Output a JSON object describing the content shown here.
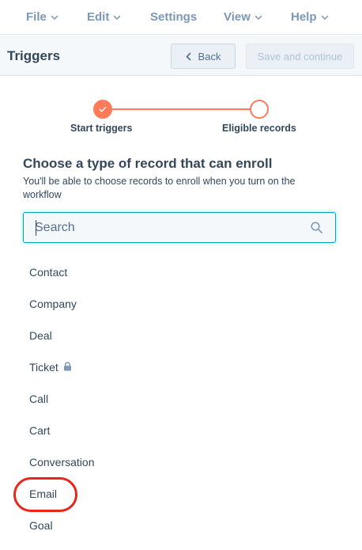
{
  "menu": {
    "items": [
      {
        "label": "File"
      },
      {
        "label": "Edit"
      },
      {
        "label": "Settings"
      },
      {
        "label": "View"
      },
      {
        "label": "Help"
      }
    ]
  },
  "header": {
    "title": "Triggers",
    "back_label": "Back",
    "save_label": "Save and continue"
  },
  "stepper": {
    "steps": [
      {
        "label": "Start triggers",
        "status": "complete"
      },
      {
        "label": "Eligible records",
        "status": "upcoming"
      }
    ],
    "accent_color": "#ff7a59"
  },
  "section": {
    "title": "Choose a type of record that can enroll",
    "subtitle": "You'll be able to choose records to enroll when you turn on the workflow"
  },
  "search": {
    "placeholder": "Search",
    "value": ""
  },
  "records": {
    "items": [
      {
        "label": "Contact",
        "locked": false
      },
      {
        "label": "Company",
        "locked": false
      },
      {
        "label": "Deal",
        "locked": false
      },
      {
        "label": "Ticket",
        "locked": true
      },
      {
        "label": "Call",
        "locked": false
      },
      {
        "label": "Cart",
        "locked": false
      },
      {
        "label": "Conversation",
        "locked": false
      },
      {
        "label": "Email",
        "locked": false,
        "highlighted": true
      },
      {
        "label": "Goal",
        "locked": false
      }
    ]
  },
  "annotation": {
    "highlight_color": "#e8261a"
  }
}
